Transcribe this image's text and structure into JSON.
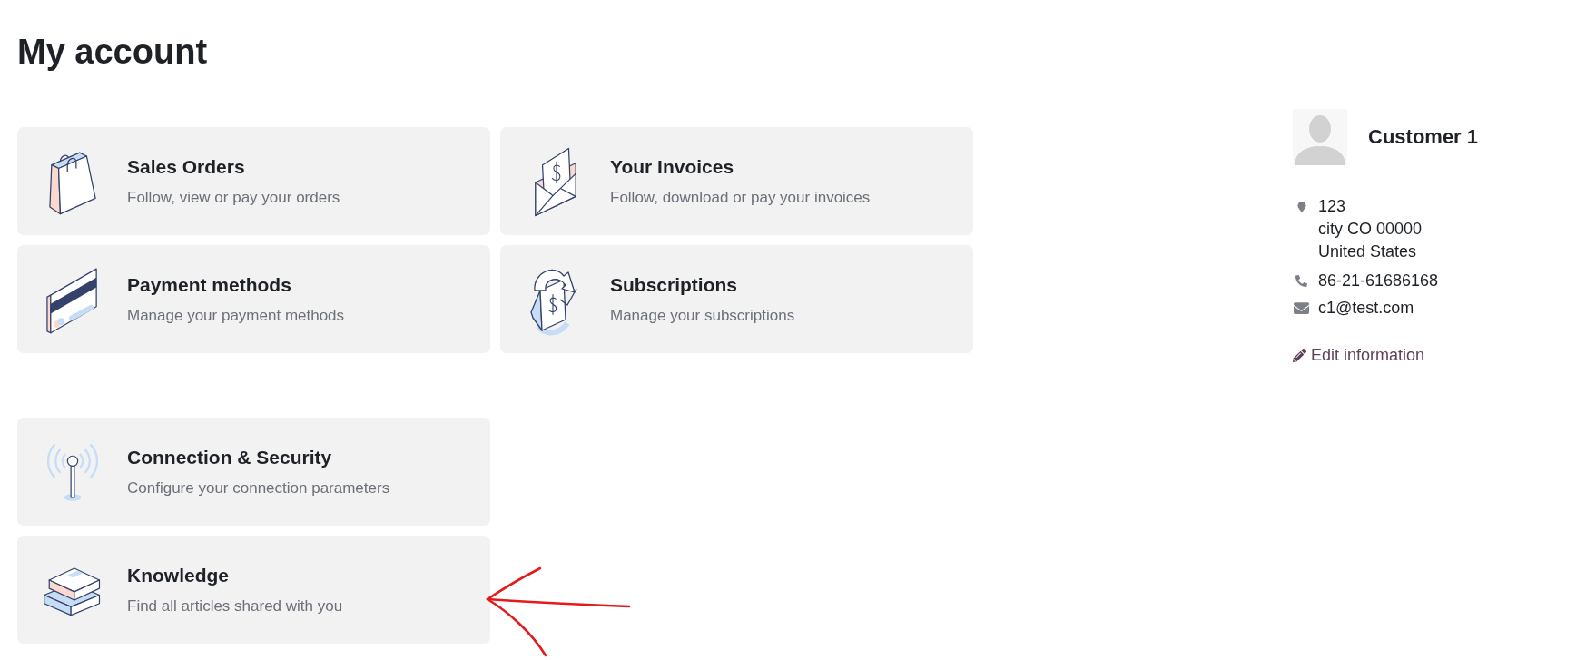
{
  "page": {
    "title": "My account"
  },
  "sections": [
    {
      "cards": [
        {
          "kind": "orders",
          "title": "Sales Orders",
          "description": "Follow, view or pay your orders"
        },
        {
          "kind": "invoices",
          "title": "Your Invoices",
          "description": "Follow, download or pay your invoices"
        },
        {
          "kind": "payment",
          "title": "Payment methods",
          "description": "Manage your payment methods"
        },
        {
          "kind": "subscriptions",
          "title": "Subscriptions",
          "description": "Manage your subscriptions"
        }
      ]
    },
    {
      "cards": [
        {
          "kind": "connection",
          "title": "Connection & Security",
          "description": "Configure your connection parameters"
        },
        {
          "kind": "knowledge",
          "title": "Knowledge",
          "description": "Find all articles shared with you"
        }
      ]
    }
  ],
  "profile": {
    "name": "Customer 1",
    "address": [
      "123",
      "city CO 00000",
      "United States"
    ],
    "phone": "86-21-61686168",
    "email": "c1@test.com",
    "edit_link": "Edit information"
  }
}
